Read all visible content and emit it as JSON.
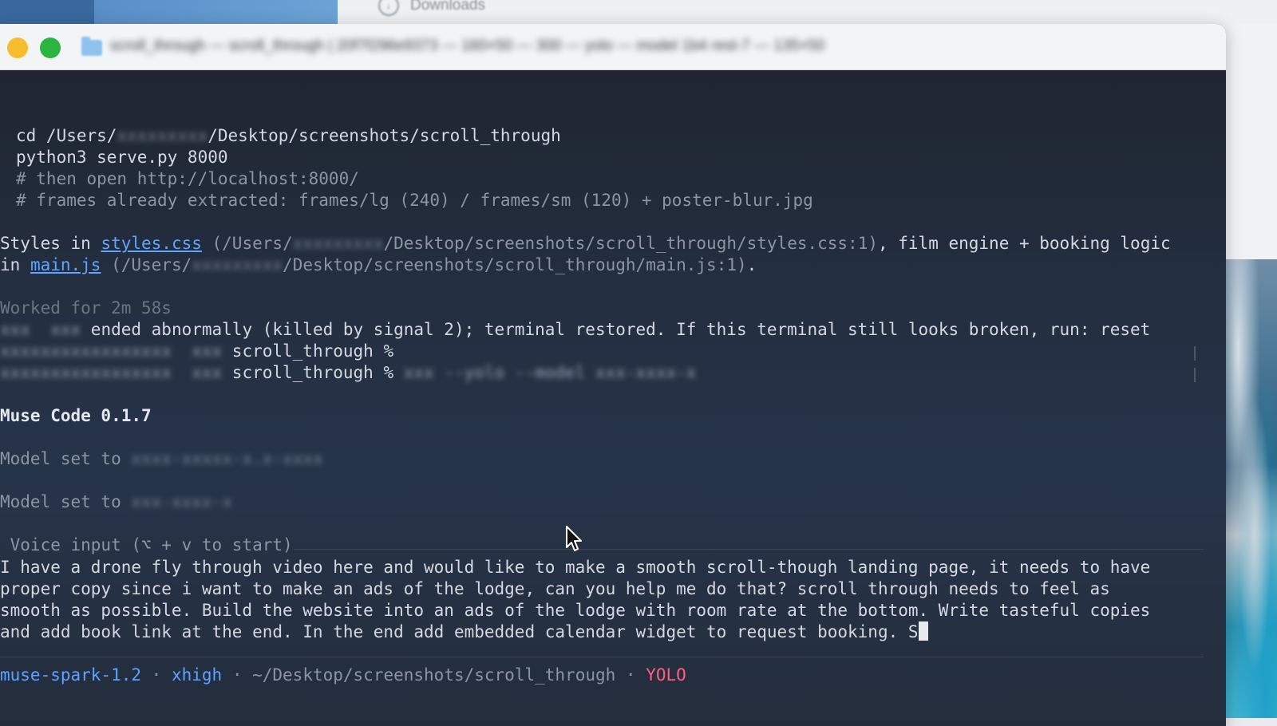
{
  "background": {
    "downloads_label": "Downloads",
    "downloads_icon": "download-circle-icon"
  },
  "window": {
    "title": "scroll_through — scroll_through | 20f7f296e9373 — 160×50 — 300 — yolo — model 1b4 rest-7 — 135×50"
  },
  "terminal": {
    "cmd_cd_prefix": "cd /Users/",
    "cmd_cd_user": "xxxxxxxxx",
    "cmd_cd_suffix": "/Desktop/screenshots/scroll_through",
    "cmd_serve": "python3 serve.py 8000",
    "comment_open": "# then open http://localhost:8000/",
    "comment_frames": "# frames already extracted: frames/lg (240) / frames/sm (120) + poster-blur.jpg",
    "styles_prefix": "Styles in ",
    "styles_link": "styles.css",
    "styles_path_a": " (/Users/",
    "styles_path_user": "xxxxxxxxx",
    "styles_path_b": "/Desktop/screenshots/scroll_through/styles.css:1)",
    "styles_suffix": ", film engine + booking logic",
    "main_prefix": "in ",
    "main_link": "main.js",
    "main_path_a": " (/Users/",
    "main_path_user": "xxxxxxxxx",
    "main_path_b": "/Desktop/screenshots/scroll_through/main.js:1)",
    "main_suffix": ".",
    "worked_for": "Worked for 2m 58s",
    "abnormal_blur": "xxx  xxx ",
    "abnormal_text": "ended abnormally (killed by signal 2); terminal restored. If this terminal still looks broken, run: reset",
    "prompt1_blur": "xxxxxxxxxxxxxxxxx  xxx ",
    "prompt1_dir": "scroll_through %",
    "prompt2_blur": "xxxxxxxxxxxxxxxxx  xxx ",
    "prompt2_dir": "scroll_through %",
    "prompt2_cmd_blur": " xxx --yolo --model xxx-xxxx-x",
    "app_name": "Muse Code 0.1.7",
    "model_set_1_label": "Model set to ",
    "model_set_1_value": "xxxx-xxxxx-x.x-xxxx",
    "model_set_2_label": "Model set to ",
    "model_set_2_value": "xxx-xxxx-x",
    "voice_input": " Voice input (⌥ + v to start)",
    "prompt_line_1": "I have a drone fly through video here and would like to make a smooth scroll-though landing page, it needs to have",
    "prompt_line_2": "proper copy since i want to make an ads of the lodge, can you help me do that? scroll through needs to feel as",
    "prompt_line_3": "smooth as possible. Build the website into an ads of the lodge with room rate at the bottom. Write tasteful copies",
    "prompt_line_4": "and add book link at the end. In the end add embedded calendar widget to request booking. S",
    "status_model": "muse-spark-1.2",
    "status_sep1": " · ",
    "status_effort": "xhigh",
    "status_sep2": " · ",
    "status_path": "~/Desktop/screenshots/scroll_through",
    "status_sep3": " · ",
    "status_mode": "YOLO"
  },
  "colors": {
    "terminal_bg": "#232a36",
    "link": "#5fa4ff",
    "yolo": "#ff5f7e",
    "traffic_yellow": "#f6be2f",
    "traffic_green": "#29b53f"
  },
  "icons": [
    "download-circle-icon",
    "folder-icon",
    "minimize-button",
    "zoom-button",
    "mouse-pointer-icon"
  ]
}
